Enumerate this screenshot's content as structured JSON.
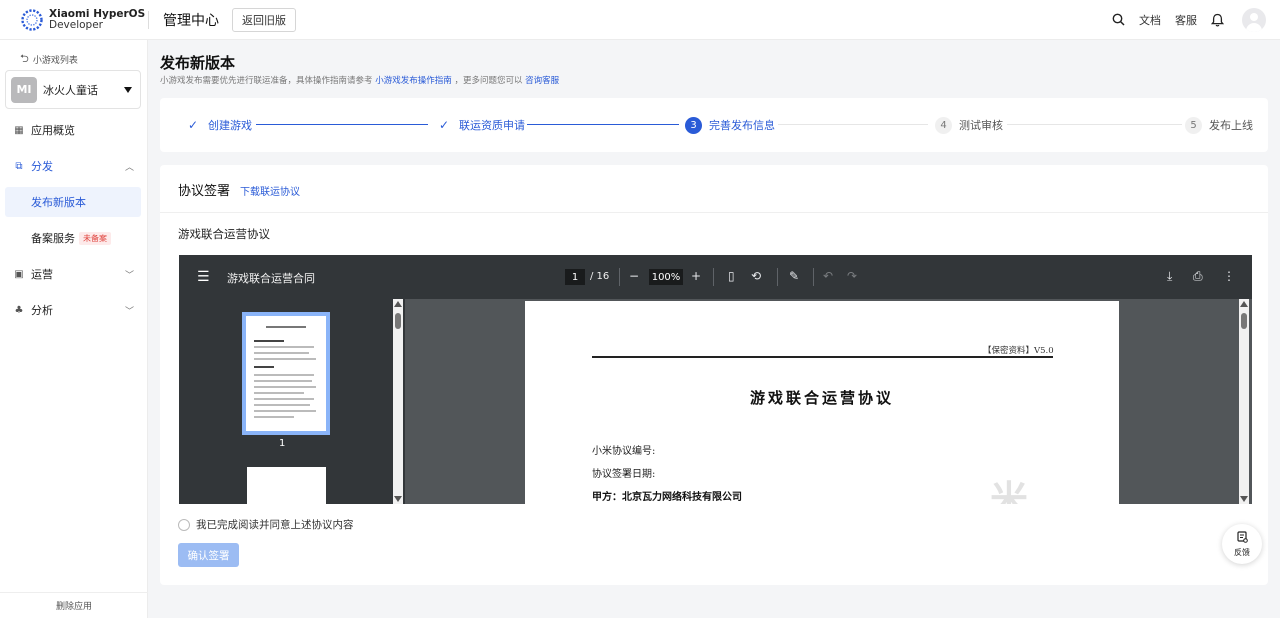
{
  "header": {
    "logo_line1": "Xiaomi HyperOS",
    "logo_line2": "Developer",
    "title": "管理中心",
    "old_version_button": "返回旧版",
    "docs": "文档",
    "support": "客服",
    "icons": [
      "search-icon",
      "bell-icon",
      "avatar"
    ]
  },
  "sidebar": {
    "back_label": "小游戏列表",
    "app_name": "冰火人童话",
    "app_icon_text": "MI",
    "nav": {
      "overview": "应用概览",
      "distribution": "分发",
      "publish_new": "发布新版本",
      "filing": "备案服务",
      "filing_badge": "未备案",
      "operations": "运营",
      "analytics": "分析"
    },
    "delete_app": "删除应用"
  },
  "page": {
    "title": "发布新版本",
    "subtitle_pre": "小游戏发布需要优先进行联运准备，具体操作指南请参考",
    "subtitle_link1": "小游戏发布操作指南",
    "subtitle_mid": "，更多问题您可以",
    "subtitle_link2": "咨询客服"
  },
  "steps": [
    {
      "label": "创建游戏",
      "status": "done"
    },
    {
      "label": "联运资质申请",
      "status": "done"
    },
    {
      "num": "3",
      "label": "完善发布信息",
      "status": "current"
    },
    {
      "num": "4",
      "label": "测试审核",
      "status": "pending"
    },
    {
      "num": "5",
      "label": "发布上线",
      "status": "pending"
    }
  ],
  "agreement": {
    "section_title": "协议签署",
    "download_link": "下载联运协议",
    "doc_label": "游戏联合运营协议",
    "agree_text": "我已完成阅读并同意上述协议内容",
    "confirm_button": "确认签署"
  },
  "pdf": {
    "file_name": "游戏联合运营合同",
    "current_page": "1",
    "total_pages": "/ 16",
    "zoom": "100%",
    "thumb_page": "1",
    "confidential": "【保密资料】V5.0",
    "doc_heading": "游戏联合运营协议",
    "field_number": "小米协议编号:",
    "field_date": "协议签署日期:",
    "party_a": "甲方：北京瓦力网络科技有限公司",
    "watermark": "米"
  },
  "feedback": "反馈",
  "colors": {
    "accent": "#2a5bd7",
    "badge_red": "#e0443e",
    "pdf_toolbar": "#323639"
  }
}
